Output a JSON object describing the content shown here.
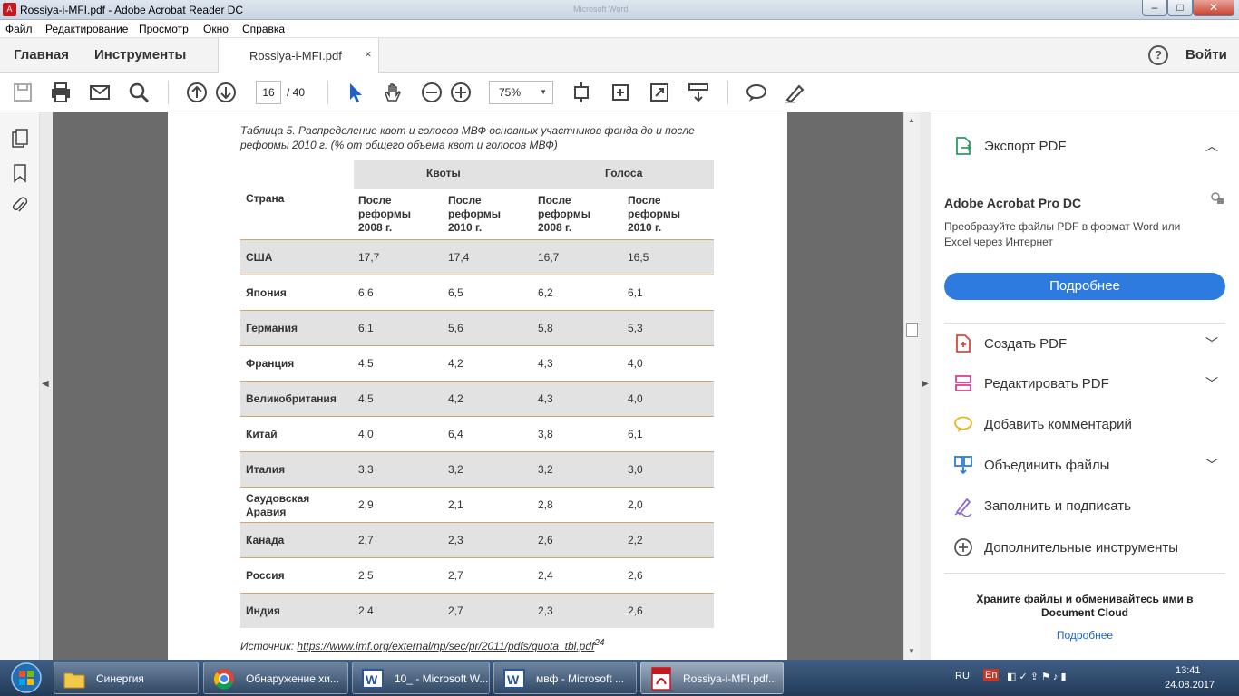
{
  "window": {
    "title": "Rossiya-i-MFI.pdf - Adobe Acrobat Reader DC",
    "ghost_title": "Microsoft Word",
    "minimize": "–",
    "maximize": "□",
    "close": "✕"
  },
  "menu": [
    "Файл",
    "Редактирование",
    "Просмотр",
    "Окно",
    "Справка"
  ],
  "tabs": {
    "home": "Главная",
    "tools": "Инструменты",
    "doc": "Rossiya-i-MFI.pdf",
    "close": "×",
    "help": "?",
    "signin": "Войти"
  },
  "toolbar": {
    "page_current": "16",
    "page_total": "/ 40",
    "zoom": "75%",
    "zoom_arrow": "▼"
  },
  "document": {
    "caption": "Таблица 5. Распределение квот и голосов МВФ основных участников фонда до и после реформы 2010 г. (% от общего объема квот и голосов МВФ)",
    "group_quotas": "Квоты",
    "group_votes": "Голоса",
    "col_country": "Страна",
    "col_after_2008": "После реформы 2008 г.",
    "col_after_2010": "После реформы 2010 г.",
    "rows": [
      {
        "country": "США",
        "q2008": "17,7",
        "q2010": "17,4",
        "v2008": "16,7",
        "v2010": "16,5"
      },
      {
        "country": "Япония",
        "q2008": "6,6",
        "q2010": "6,5",
        "v2008": "6,2",
        "v2010": "6,1"
      },
      {
        "country": "Германия",
        "q2008": "6,1",
        "q2010": "5,6",
        "v2008": "5,8",
        "v2010": "5,3"
      },
      {
        "country": "Франция",
        "q2008": "4,5",
        "q2010": "4,2",
        "v2008": "4,3",
        "v2010": "4,0"
      },
      {
        "country": "Великобритания",
        "q2008": "4,5",
        "q2010": "4,2",
        "v2008": "4,3",
        "v2010": "4,0"
      },
      {
        "country": "Китай",
        "q2008": "4,0",
        "q2010": "6,4",
        "v2008": "3,8",
        "v2010": "6,1"
      },
      {
        "country": "Италия",
        "q2008": "3,3",
        "q2010": "3,2",
        "v2008": "3,2",
        "v2010": "3,0"
      },
      {
        "country": "Саудовская Аравия",
        "q2008": "2,9",
        "q2010": "2,1",
        "v2008": "2,8",
        "v2010": "2,0"
      },
      {
        "country": "Канада",
        "q2008": "2,7",
        "q2010": "2,3",
        "v2008": "2,6",
        "v2010": "2,2"
      },
      {
        "country": "Россия",
        "q2008": "2,5",
        "q2010": "2,7",
        "v2008": "2,4",
        "v2010": "2,6"
      },
      {
        "country": "Индия",
        "q2008": "2,4",
        "q2010": "2,7",
        "v2008": "2,3",
        "v2010": "2,6"
      }
    ],
    "source_label": "Источник: ",
    "source_url": "https://www.imf.org/external/np/sec/pr/2011/pdfs/quota_tbl.pdf",
    "source_footnote": "24"
  },
  "right_panel": {
    "export_pdf": "Экспорт PDF",
    "pro_title": "Adobe Acrobat Pro DC",
    "pro_desc": "Преобразуйте файлы PDF в формат Word или Excel через Интернет",
    "pro_button": "Подробнее",
    "tools": [
      {
        "label": "Создать PDF",
        "icon": "create-pdf-icon",
        "chevron": true
      },
      {
        "label": "Редактировать PDF",
        "icon": "edit-pdf-icon",
        "chevron": true
      },
      {
        "label": "Добавить комментарий",
        "icon": "comment-icon",
        "chevron": false
      },
      {
        "label": "Объединить файлы",
        "icon": "combine-files-icon",
        "chevron": true
      },
      {
        "label": "Заполнить и подписать",
        "icon": "fill-sign-icon",
        "chevron": false
      },
      {
        "label": "Дополнительные инструменты",
        "icon": "more-tools-icon",
        "chevron": false
      }
    ],
    "cloud_text": "Храните файлы и обменивайтесь ими в Document Cloud",
    "cloud_link": "Подробнее"
  },
  "taskbar": {
    "items": [
      {
        "label": "Синергия",
        "icon": "folder-icon"
      },
      {
        "label": "Обнаружение хи...",
        "icon": "chrome-icon"
      },
      {
        "label": "10_ - Microsoft W...",
        "icon": "word-icon"
      },
      {
        "label": "мвф - Microsoft ...",
        "icon": "word-icon"
      },
      {
        "label": "Rossiya-i-MFI.pdf...",
        "icon": "acrobat-icon"
      }
    ],
    "lang": "RU",
    "lang2": "En",
    "time": "13:41",
    "date": "24.08.2017"
  },
  "colors": {
    "accent_blue": "#2d7bde",
    "table_shade": "#e2e2e2",
    "table_rule": "#c9a66b",
    "doc_background": "#6b6b6b"
  }
}
